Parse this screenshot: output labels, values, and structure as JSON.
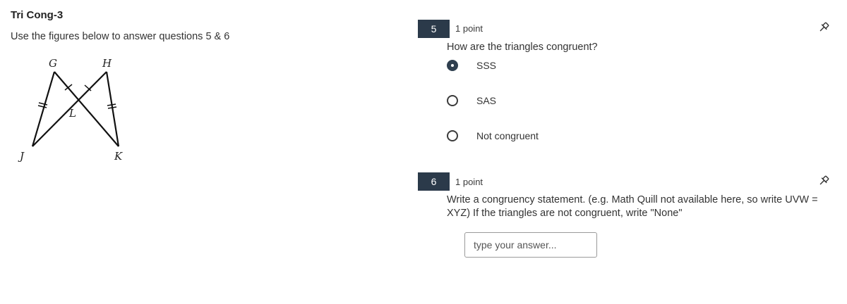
{
  "left": {
    "title": "Tri Cong-3",
    "instructions": "Use the figures below to answer questions 5 & 6",
    "figure_labels": {
      "G": "G",
      "H": "H",
      "L": "L",
      "J": "J",
      "K": "K"
    }
  },
  "questions": [
    {
      "number": "5",
      "points": "1 point",
      "prompt": "How are the triangles congruent?",
      "options": [
        {
          "label": "SSS",
          "selected": true
        },
        {
          "label": "SAS",
          "selected": false
        },
        {
          "label": "Not congruent",
          "selected": false
        }
      ],
      "pin_icon": "pin-icon"
    },
    {
      "number": "6",
      "points": "1 point",
      "prompt_line1": "Write a congruency statement. (e.g. Math Quill not available here, so write UVW =",
      "prompt_line2": "XYZ)  If the triangles are not congruent, write \"None\"",
      "answer_placeholder": "type your answer...",
      "answer_value": "",
      "pin_icon": "pin-icon"
    }
  ],
  "colors": {
    "number_badge": "#2b3a4a",
    "selected_radio": "#2f3f4f"
  }
}
